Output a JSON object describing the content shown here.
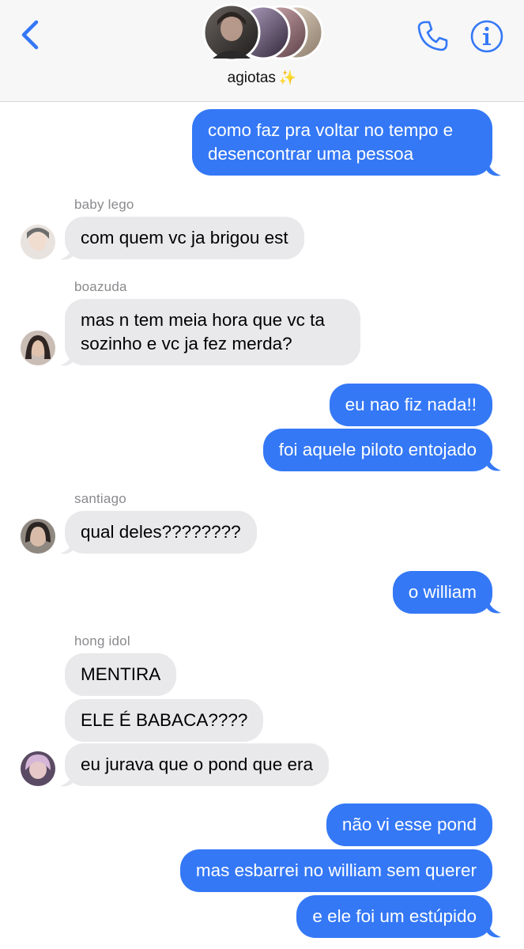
{
  "header": {
    "group_name": "agiotas",
    "group_emoji": "✨",
    "icons": {
      "back": "chevron-left-icon",
      "call": "phone-icon",
      "info": "info-icon"
    },
    "accent_color": "#3478f6"
  },
  "messages": [
    {
      "id": "m1",
      "direction": "outgoing",
      "text": "como faz pra voltar no tempo e"
    },
    {
      "id": "m1b",
      "direction": "outgoing",
      "text": "desencontrar uma pessoa"
    },
    {
      "id": "m2",
      "direction": "incoming",
      "sender": "baby lego",
      "text": "com quem vc ja brigou est"
    },
    {
      "id": "m3",
      "direction": "incoming",
      "sender": "boazuda",
      "text": "mas n tem meia hora que vc ta"
    },
    {
      "id": "m3b",
      "direction": "incoming",
      "text": "sozinho e vc ja fez merda?"
    },
    {
      "id": "m4",
      "direction": "outgoing",
      "text": "eu nao fiz nada!!"
    },
    {
      "id": "m5",
      "direction": "outgoing",
      "text": "foi aquele piloto entojado"
    },
    {
      "id": "m6",
      "direction": "incoming",
      "sender": "santiago",
      "text": "qual deles????????"
    },
    {
      "id": "m7",
      "direction": "outgoing",
      "text": "o william"
    },
    {
      "id": "m8",
      "direction": "incoming",
      "sender": "hong idol",
      "text": "MENTIRA"
    },
    {
      "id": "m9",
      "direction": "incoming",
      "text": "ELE É BABACA????"
    },
    {
      "id": "m10",
      "direction": "incoming",
      "text": "eu jurava que o pond que era"
    },
    {
      "id": "m11",
      "direction": "outgoing",
      "text": "não vi esse pond"
    },
    {
      "id": "m12",
      "direction": "outgoing",
      "text": "mas esbarrei no william sem querer"
    },
    {
      "id": "m13",
      "direction": "outgoing",
      "text": "e ele foi um estúpido"
    }
  ],
  "colors": {
    "outgoing_bubble": "#3478f6",
    "incoming_bubble": "#e9e9eb",
    "sender_label": "#8a8a8e"
  }
}
